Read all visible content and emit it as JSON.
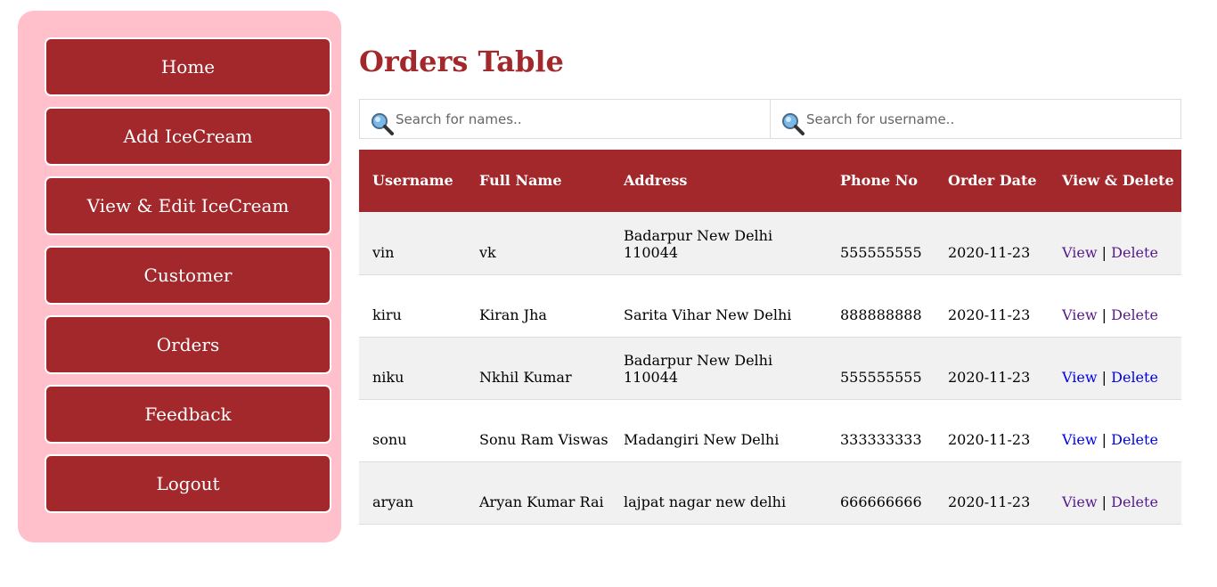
{
  "nav": [
    {
      "label": "Home"
    },
    {
      "label": "Add IceCream"
    },
    {
      "label": "View & Edit IceCream"
    },
    {
      "label": "Customer"
    },
    {
      "label": "Orders"
    },
    {
      "label": "Feedback"
    },
    {
      "label": "Logout"
    }
  ],
  "page_title": "Orders Table",
  "search": {
    "names_placeholder": "Search for names..",
    "username_placeholder": "Search for username.."
  },
  "table": {
    "headers": [
      "Username",
      "Full Name",
      "Address",
      "Phone No",
      "Order Date",
      "View & Delete"
    ],
    "view_label": "View",
    "separator": "|",
    "delete_label": "Delete",
    "rows": [
      {
        "username": "vin",
        "full_name": "vk",
        "address": "Badarpur New Delhi 110044",
        "phone": "555555555",
        "date": "2020-11-23"
      },
      {
        "username": "kiru",
        "full_name": "Kiran Jha",
        "address": "Sarita Vihar New Delhi",
        "phone": "888888888",
        "date": "2020-11-23"
      },
      {
        "username": "niku",
        "full_name": "Nkhil Kumar",
        "address": "Badarpur New Delhi 110044",
        "phone": "555555555",
        "date": "2020-11-23"
      },
      {
        "username": "sonu",
        "full_name": "Sonu Ram Viswas",
        "address": "Madangiri New Delhi",
        "phone": "333333333",
        "date": "2020-11-23"
      },
      {
        "username": "aryan",
        "full_name": "Aryan Kumar Rai",
        "address": "lajpat nagar new delhi",
        "phone": "666666666",
        "date": "2020-11-23"
      }
    ]
  }
}
